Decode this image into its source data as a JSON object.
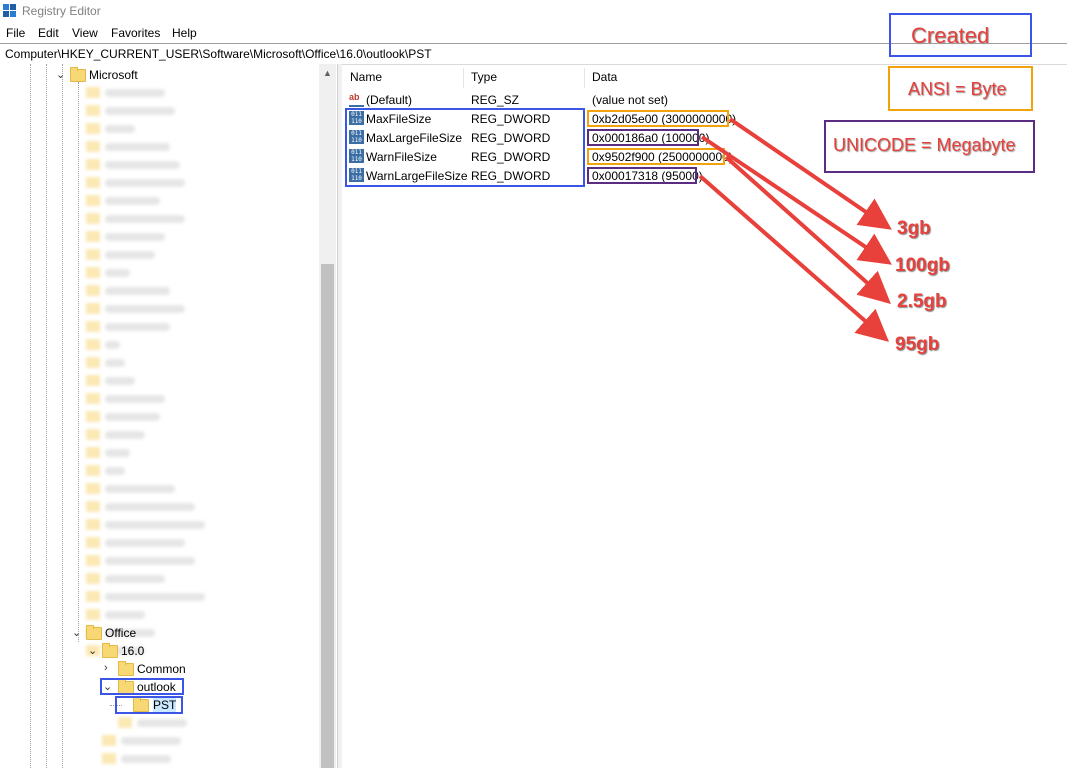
{
  "window": {
    "title": "Registry Editor"
  },
  "menu": [
    "File",
    "Edit",
    "View",
    "Favorites",
    "Help"
  ],
  "address": "Computer\\HKEY_CURRENT_USER\\Software\\Microsoft\\Office\\16.0\\outlook\\PST",
  "tree": {
    "microsoft": "Microsoft",
    "office": "Office",
    "version": "16.0",
    "common": "Common",
    "outlook": "outlook",
    "pst": "PST"
  },
  "columns": {
    "name": "Name",
    "type": "Type",
    "data": "Data"
  },
  "rows": [
    {
      "name": "(Default)",
      "type": "REG_SZ",
      "data": "(value not set)",
      "icon": "string-value-icon"
    },
    {
      "name": "MaxFileSize",
      "type": "REG_DWORD",
      "data": "0xb2d05e00 (3000000000)",
      "icon": "dword-value-icon"
    },
    {
      "name": "MaxLargeFileSize",
      "type": "REG_DWORD",
      "data": "0x000186a0 (100000)",
      "icon": "dword-value-icon"
    },
    {
      "name": "WarnFileSize",
      "type": "REG_DWORD",
      "data": "0x9502f900 (2500000000)",
      "icon": "dword-value-icon"
    },
    {
      "name": "WarnLargeFileSize",
      "type": "REG_DWORD",
      "data": "0x00017318 (95000)",
      "icon": "dword-value-icon"
    }
  ],
  "legend": {
    "created": "Created",
    "ansi": "ANSI = Byte",
    "unicode": "UNICODE = Megabyte"
  },
  "annotations": [
    "3gb",
    "100gb",
    "2.5gb",
    "95gb"
  ],
  "colors": {
    "blue": "#3b55e6",
    "orange": "#f0a30a",
    "purple": "#5b2d82",
    "red": "#e8403b"
  }
}
